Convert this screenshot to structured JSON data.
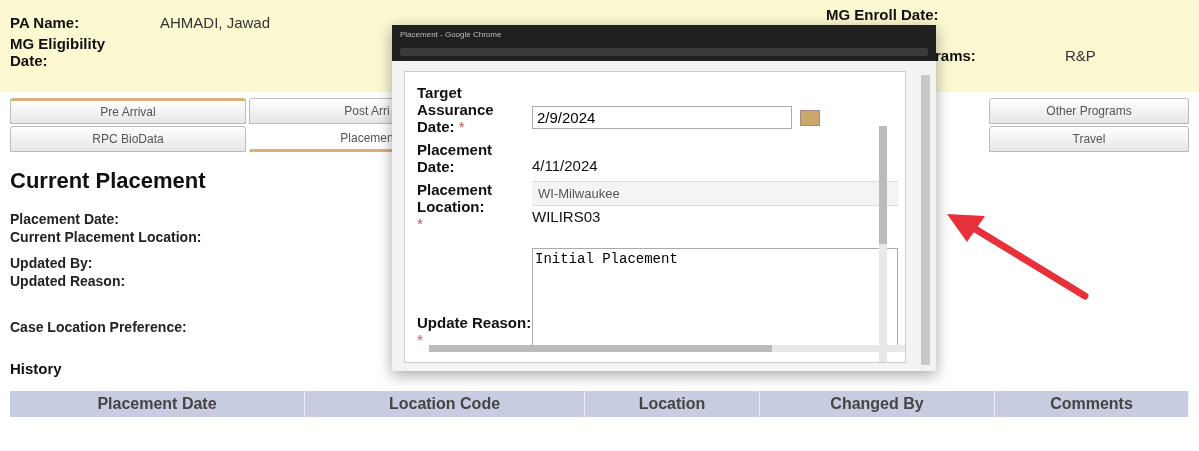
{
  "header": {
    "fields": [
      {
        "label": "PA Name:",
        "value": "AHMADI, Jawad"
      },
      {
        "label": "MG Eligibility Date:"
      }
    ],
    "right_fields": [
      {
        "label": "MG Enroll Date:"
      },
      {
        "label": "rams:",
        "value": "R&P"
      }
    ]
  },
  "tab_rows": [
    [
      {
        "label": "Pre Arrival",
        "selected": false
      },
      {
        "label": "Post Arri",
        "selected": false
      },
      {
        "label": "Other Programs",
        "selected": false
      }
    ],
    [
      {
        "label": "RPC BioData",
        "selected": false
      },
      {
        "label": "Placemen",
        "selected": true
      },
      {
        "label": "Travel",
        "selected": false
      }
    ]
  ],
  "section": {
    "title": "Current Placement",
    "fields": [
      "Placement Date:",
      "Current Placement Location:",
      "Updated By:",
      "Updated Reason:",
      "Case Location Preference:"
    ],
    "history_title": "History"
  },
  "history_table": {
    "columns": [
      "Placement Date",
      "Location Code",
      "Location",
      "Changed By",
      "Comments"
    ]
  },
  "popup": {
    "title": "Placement - Google Chrome",
    "target_date": {
      "label": "Target Assurance Date:",
      "required_mark": "*",
      "value": "2/9/2024"
    },
    "placement_date": {
      "label": "Placement Date:",
      "value": "4/11/2024"
    },
    "location": {
      "label": "Placement Location:",
      "required_mark": "*",
      "value": "WI-Milwaukee",
      "code": "WILIRS03"
    },
    "reason": {
      "label": "Update Reason:",
      "required_mark": "*",
      "value": "Initial Placement"
    }
  }
}
